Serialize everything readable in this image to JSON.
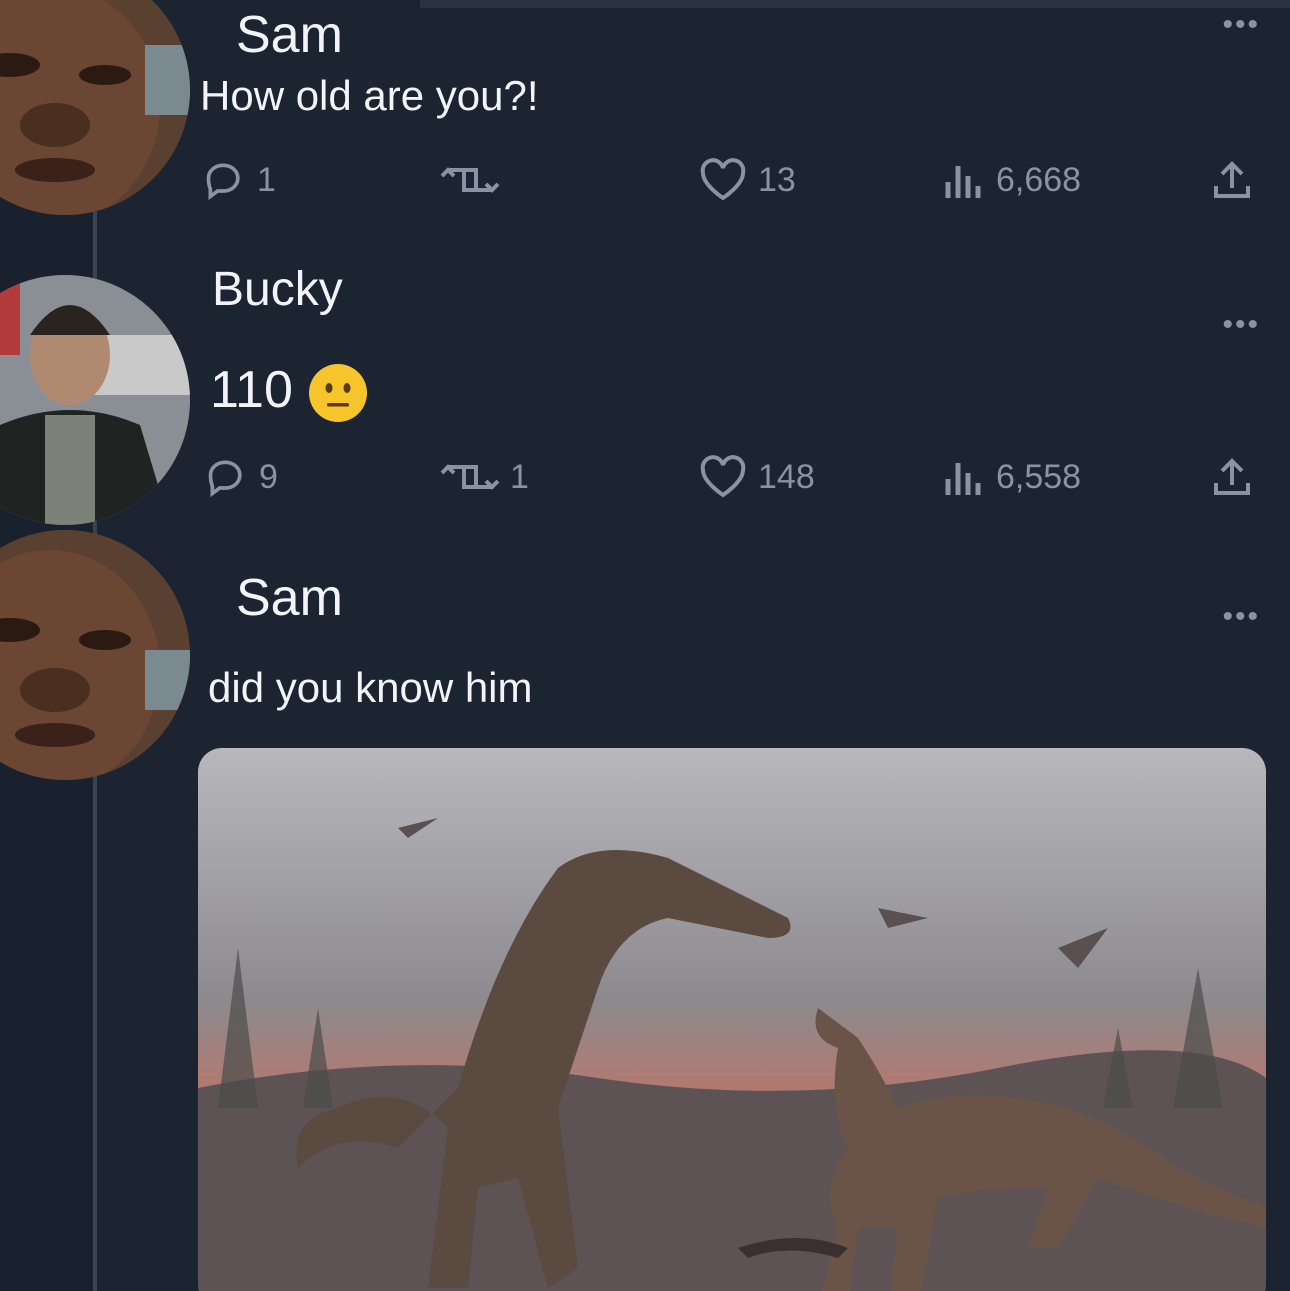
{
  "thread": [
    {
      "author": "Sam",
      "text": "How old are you?!",
      "stats": {
        "replies": "1",
        "retweets": "",
        "likes": "13",
        "views": "6,668"
      }
    },
    {
      "author": "Bucky",
      "text": "110",
      "emoji": "neutral-face",
      "stats": {
        "replies": "9",
        "retweets": "1",
        "likes": "148",
        "views": "6,558"
      }
    },
    {
      "author": "Sam",
      "text": "did you know him",
      "media": "dinosaur-painting"
    }
  ],
  "icons": {
    "reply": "reply-icon",
    "retweet": "retweet-icon",
    "like": "heart-icon",
    "views": "views-icon",
    "share": "share-icon",
    "more": "more-icon"
  },
  "colors": {
    "background": "#1c2331",
    "text": "#f2f4f7",
    "muted": "#8a93a3"
  }
}
